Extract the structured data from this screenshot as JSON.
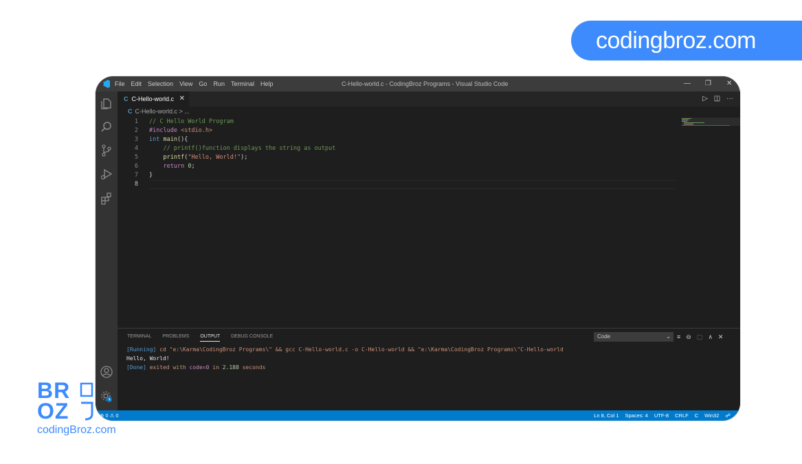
{
  "brand": {
    "pill_text": "codingbroz.com",
    "logo_line1": "BR",
    "logo_line2": "OZ",
    "logo_caption": "codingBroz.com",
    "accent": "#3d8bfd"
  },
  "titlebar": {
    "menus": [
      "File",
      "Edit",
      "Selection",
      "View",
      "Go",
      "Run",
      "Terminal",
      "Help"
    ],
    "title": "C-Hello-world.c - CodingBroz Programs - Visual Studio Code",
    "minimize": "—",
    "maximize": "❐",
    "close": "✕"
  },
  "activitybar": {
    "icons": [
      "explorer-icon",
      "search-icon",
      "source-control-icon",
      "run-debug-icon",
      "extensions-icon",
      "account-icon",
      "settings-icon"
    ]
  },
  "tab": {
    "lang": "C",
    "filename": "C-Hello-world.c",
    "close": "✕"
  },
  "editor_actions": {
    "run": "▷",
    "split": "◫",
    "more": "···"
  },
  "breadcrumb": {
    "lang": "C",
    "text": "C-Hello-world.c > ..."
  },
  "code": {
    "line_numbers": [
      "1",
      "2",
      "3",
      "4",
      "5",
      "6",
      "7",
      "8"
    ],
    "active_line": "8"
  },
  "panel": {
    "tabs": [
      "TERMINAL",
      "PROBLEMS",
      "OUTPUT",
      "DEBUG CONSOLE"
    ],
    "active_tab": "OUTPUT",
    "select_value": "Code",
    "output": {
      "line1_prefix": "[Running]",
      "line1_cmd": " cd \"e:\\Karma\\CodingBroz Programs\\\" && gcc C-Hello-world.c -o C-Hello-world && \"e:\\Karma\\CodingBroz Programs\\\"C-Hello-world",
      "line2": "Hello, World!",
      "line3_prefix": "[Done]",
      "line3_a": " exited with ",
      "line3_code": "code=0",
      "line3_b": " in ",
      "line3_time": "2.188",
      "line3_c": " seconds"
    }
  },
  "statusbar": {
    "problems": "⊗ 0 ⚠ 0",
    "position": "Ln 8, Col 1",
    "spaces": "Spaces: 4",
    "encoding": "UTF-8",
    "eol": "CRLF",
    "language": "C",
    "platform": "Win32",
    "feedback": "☍",
    "bell": "🔔"
  }
}
